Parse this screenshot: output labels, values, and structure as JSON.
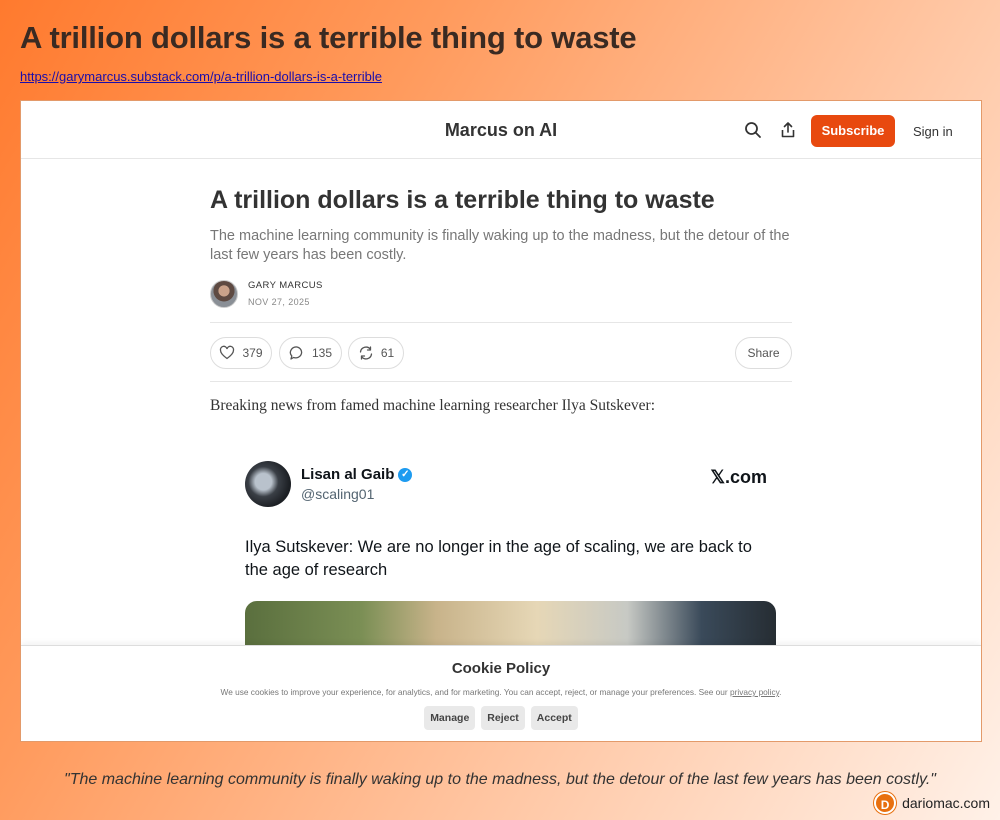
{
  "page": {
    "title": "A trillion dollars is a terrible thing to waste",
    "link": "https://garymarcus.substack.com/p/a-trillion-dollars-is-a-terrible",
    "caption": "\"The machine learning community is finally waking up to the madness, but the detour of the last few years has been costly.\"",
    "brand": "dariomac.com"
  },
  "header": {
    "publication": "Marcus on AI",
    "subscribe_label": "Subscribe",
    "signin_label": "Sign in",
    "accent": "#e8490f"
  },
  "article": {
    "title": "A trillion dollars is a terrible thing to waste",
    "subtitle": "The machine learning community is finally waking up to the madness, but the detour of the last few years has been costly.",
    "author": "GARY MARCUS",
    "date": "NOV 27, 2025",
    "likes": "379",
    "comments": "135",
    "restacks": "61",
    "share_label": "Share",
    "body": "Breaking news from famed machine learning researcher Ilya Sutskever:"
  },
  "tweet": {
    "name": "Lisan al Gaib",
    "handle": "@scaling01",
    "source": "𝕏.com",
    "text": "Ilya Sutskever: We are no longer in the age of scaling, we are back to the age of research"
  },
  "cookie": {
    "title": "Cookie Policy",
    "text": "We use cookies to improve your experience, for analytics, and for marketing. You can accept, reject, or manage your preferences. See our",
    "privacy_link": "privacy policy",
    "manage_label": "Manage",
    "reject_label": "Reject",
    "accept_label": "Accept"
  }
}
